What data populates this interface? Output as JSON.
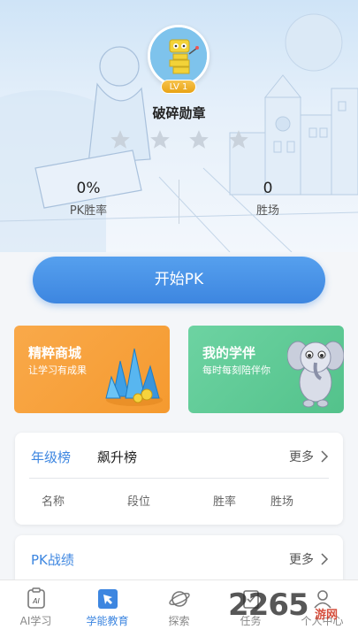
{
  "header": {
    "level_badge": "LV 1",
    "badge_name": "破碎勋章",
    "stars_total": 4,
    "stars_filled": 0,
    "stats": {
      "win_rate_value": "0%",
      "win_rate_label": "PK胜率",
      "wins_value": "0",
      "wins_label": "胜场"
    }
  },
  "start_button": {
    "label": "开始PK"
  },
  "cards": {
    "shop": {
      "title": "精粹商城",
      "subtitle": "让学习有成果"
    },
    "buddy": {
      "title": "我的学伴",
      "subtitle": "每时每刻陪伴你"
    }
  },
  "ranking": {
    "tabs": [
      "年级榜",
      "飙升榜"
    ],
    "active_tab": "年级榜",
    "more_label": "更多",
    "columns": [
      "名称",
      "段位",
      "胜率",
      "胜场"
    ]
  },
  "pk_record": {
    "title": "PK战绩",
    "more_label": "更多"
  },
  "bottom_nav": {
    "items": [
      {
        "label": "AI学习",
        "icon": "ai-icon"
      },
      {
        "label": "学能教育",
        "icon": "cursor-icon"
      },
      {
        "label": "探索",
        "icon": "planet-icon"
      },
      {
        "label": "任务",
        "icon": "task-icon"
      },
      {
        "label": "个人中心",
        "icon": "user-icon"
      }
    ],
    "active_index": 1
  },
  "watermark": {
    "text": "2265",
    "suffix": "游网"
  },
  "colors": {
    "accent": "#3d86e0",
    "shop_card": "#f7a23c",
    "buddy_card": "#5fca96",
    "level_badge": "#eeb02a"
  }
}
